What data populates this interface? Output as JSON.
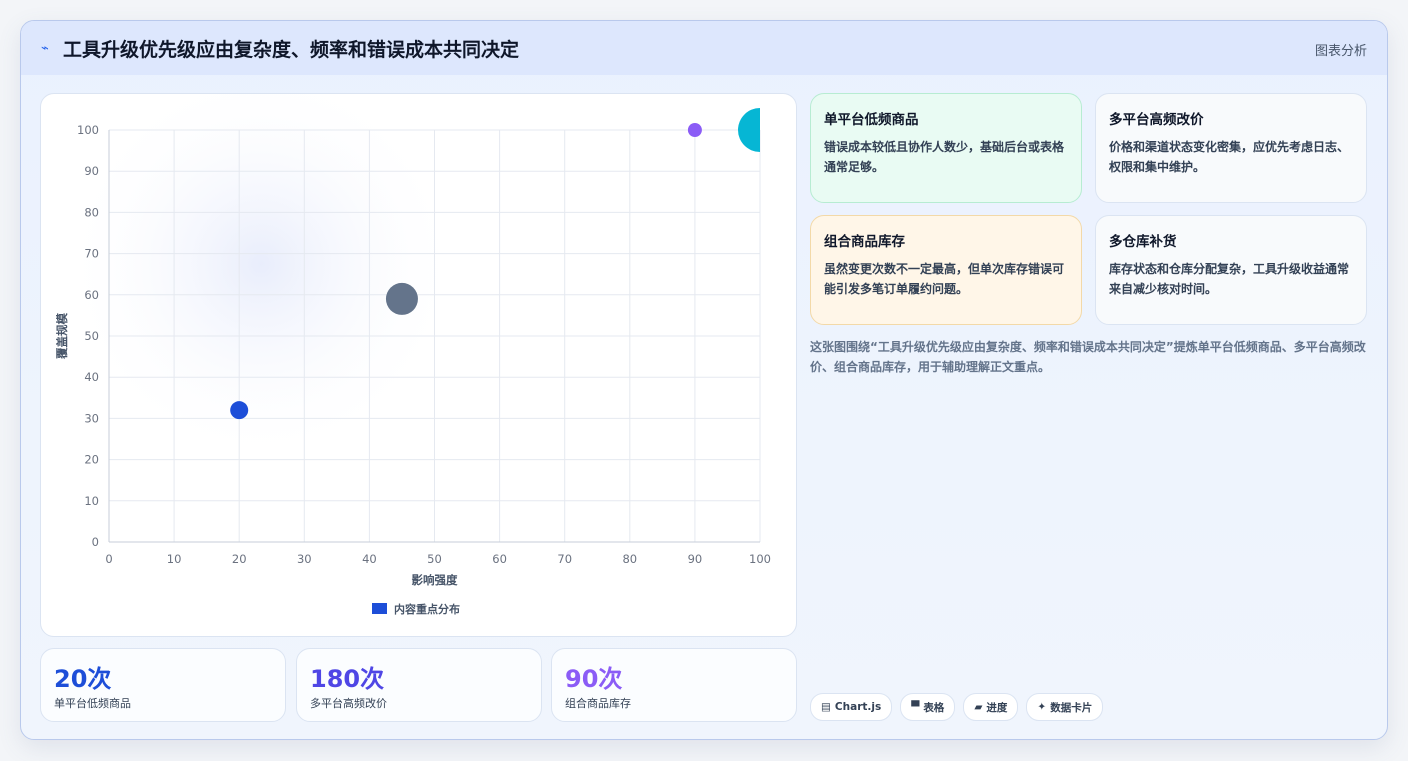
{
  "header": {
    "title": "工具升级优先级应由复杂度、频率和错误成本共同决定",
    "tag": "图表分析",
    "icon": "bolt-icon"
  },
  "chart_data": {
    "type": "scatter",
    "xlabel": "影响强度",
    "ylabel": "覆盖规模",
    "xlim": [
      0,
      100
    ],
    "ylim": [
      0,
      100
    ],
    "xticks": [
      "0",
      "10",
      "20",
      "30",
      "40",
      "50",
      "60",
      "70",
      "80",
      "90",
      "100"
    ],
    "yticks": [
      "0",
      "10",
      "20",
      "30",
      "40",
      "50",
      "60",
      "70",
      "80",
      "90",
      "100"
    ],
    "legend": "内容重点分布",
    "legend_position": "bottom",
    "grid": true,
    "points": [
      {
        "x": 20,
        "y": 32,
        "size": 9,
        "color": "#1d4ed8"
      },
      {
        "x": 45,
        "y": 59,
        "size": 16,
        "color": "#64748b"
      },
      {
        "x": 90,
        "y": 100,
        "size": 7,
        "color": "#8b5cf6"
      },
      {
        "x": 100,
        "y": 100,
        "size": 22,
        "color": "#06b6d4"
      }
    ],
    "legend_color": "#1d4ed8"
  },
  "stats": [
    {
      "value": "20次",
      "label": "单平台低频商品",
      "color": "#1d4ed8"
    },
    {
      "value": "180次",
      "label": "多平台高频改价",
      "color": "#4f46e5"
    },
    {
      "value": "90次",
      "label": "组合商品库存",
      "color": "#8b5cf6"
    }
  ],
  "notes": [
    {
      "title": "单平台低频商品",
      "desc": "错误成本较低且协作人数少，基础后台或表格通常足够。",
      "bg": "#e9fbf3",
      "border": "#b7ecd2"
    },
    {
      "title": "多平台高频改价",
      "desc": "价格和渠道状态变化密集，应优先考虑日志、权限和集中维护。",
      "bg": "#f8fafc",
      "border": "#dbe4f2"
    },
    {
      "title": "组合商品库存",
      "desc": "虽然变更次数不一定最高，但单次库存错误可能引发多笔订单履约问题。",
      "bg": "#fff6e8",
      "border": "#f3d9a8"
    },
    {
      "title": "多仓库补货",
      "desc": "库存状态和仓库分配复杂，工具升级收益通常来自减少核对时间。",
      "bg": "#f8fafc",
      "border": "#dbe4f2"
    }
  ],
  "summary": "这张图围绕“工具升级优先级应由复杂度、频率和错误成本共同决定”提炼单平台低频商品、多平台高频改价、组合商品库存，用于辅助理解正文重点。",
  "chips": [
    {
      "icon": "chart-icon",
      "glyph": "▤",
      "label": "Chart.js"
    },
    {
      "icon": "table-icon",
      "glyph": "▀",
      "label": "表格"
    },
    {
      "icon": "progress-icon",
      "glyph": "▰",
      "label": "进度"
    },
    {
      "icon": "sparkle-icon",
      "glyph": "✦",
      "label": "数据卡片"
    }
  ]
}
